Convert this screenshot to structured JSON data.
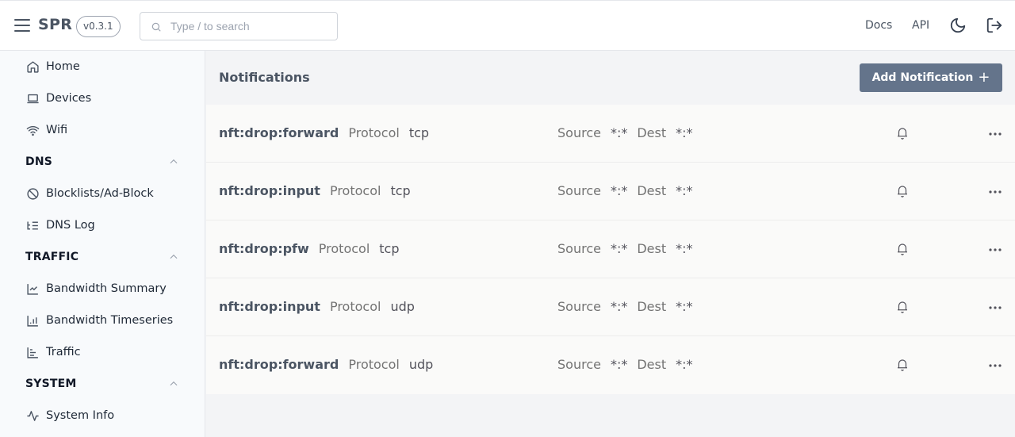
{
  "header": {
    "brand": "SPR",
    "version": "v0.3.1",
    "search_placeholder": "Type / to search",
    "links": {
      "docs": "Docs",
      "api": "API"
    },
    "icons": {
      "menu": "hamburger-icon",
      "search": "search-icon",
      "theme": "moon-icon",
      "logout": "logout-icon"
    }
  },
  "sidebar": {
    "items": [
      {
        "label": "Home",
        "icon": "home-icon"
      },
      {
        "label": "Devices",
        "icon": "laptop-icon"
      },
      {
        "label": "Wifi",
        "icon": "wifi-icon"
      }
    ],
    "sections": [
      {
        "title": "DNS",
        "expanded": true,
        "items": [
          {
            "label": "Blocklists/Ad-Block",
            "icon": "ban-icon"
          },
          {
            "label": "DNS Log",
            "icon": "list-icon"
          }
        ]
      },
      {
        "title": "TRAFFIC",
        "expanded": true,
        "items": [
          {
            "label": "Bandwidth Summary",
            "icon": "line-chart-icon"
          },
          {
            "label": "Bandwidth Timeseries",
            "icon": "bar-chart-icon"
          },
          {
            "label": "Traffic",
            "icon": "bar-chart-horizontal-icon"
          }
        ]
      },
      {
        "title": "SYSTEM",
        "expanded": true,
        "items": [
          {
            "label": "System Info",
            "icon": "activity-icon"
          }
        ]
      }
    ]
  },
  "main": {
    "title": "Notifications",
    "add_button": "Add Notification",
    "labels": {
      "protocol": "Protocol",
      "source": "Source",
      "dest": "Dest"
    },
    "notifications": [
      {
        "name": "nft:drop:forward",
        "protocol": "tcp",
        "source": "*:*",
        "dest": "*:*"
      },
      {
        "name": "nft:drop:input",
        "protocol": "tcp",
        "source": "*:*",
        "dest": "*:*"
      },
      {
        "name": "nft:drop:pfw",
        "protocol": "tcp",
        "source": "*:*",
        "dest": "*:*"
      },
      {
        "name": "nft:drop:input",
        "protocol": "udp",
        "source": "*:*",
        "dest": "*:*"
      },
      {
        "name": "nft:drop:forward",
        "protocol": "udp",
        "source": "*:*",
        "dest": "*:*"
      }
    ]
  },
  "colors": {
    "button": "#64748b",
    "sidebar_bg": "#f8fafc",
    "main_bg": "#f3f4f6",
    "row_bg": "#fafaf9"
  }
}
